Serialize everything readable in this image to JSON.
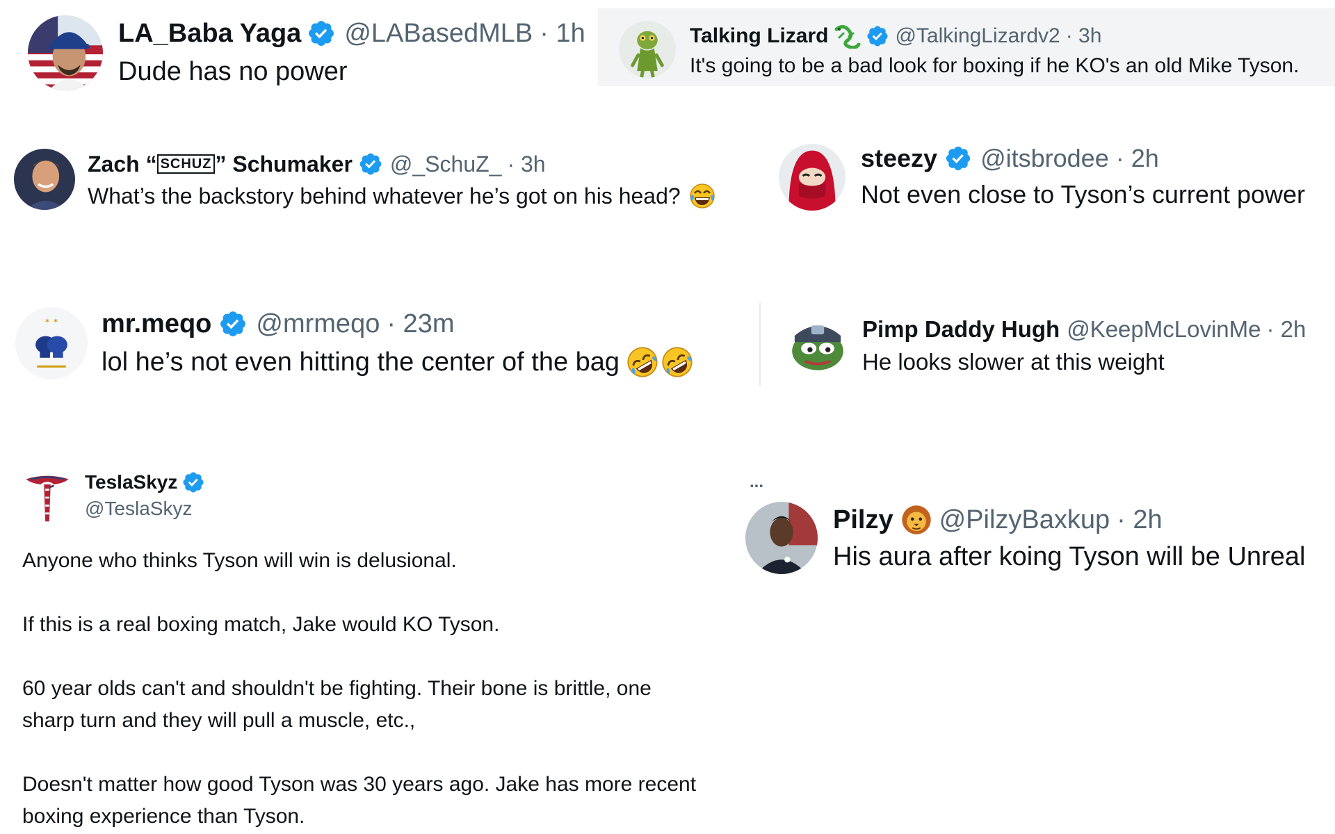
{
  "colors": {
    "text": "#0f1419",
    "secondary": "#536471",
    "verified": "#1d9bf0",
    "highlight_bg": "#f2f4f5",
    "divider": "#e6e8ea"
  },
  "tweets": [
    {
      "name": "LA_Baba Yaga",
      "handle": "@LABasedMLB",
      "time": "· 1h",
      "text": "Dude has no power",
      "icons": [
        "avatar-dodgers-man",
        "verified-badge-icon"
      ]
    },
    {
      "name": "Talking Lizard",
      "handle": "@TalkingLizardv2",
      "time": "· 3h",
      "text": "It's going to be a bad look for boxing if he KO's an old Mike Tyson.",
      "icons": [
        "avatar-gecko",
        "lizard-emoji",
        "verified-badge-icon"
      ]
    },
    {
      "name_prefix": "Zach “",
      "name_glyph": "SCHUZ",
      "name_suffix": "” Schumaker",
      "handle": "@_SchuZ_",
      "time": "· 3h",
      "text": "What’s the backstory behind whatever he’s got on his head?",
      "icons": [
        "avatar-man",
        "verified-badge-icon",
        "tears-of-joy-emoji"
      ]
    },
    {
      "name": "steezy",
      "handle": "@itsbrodee",
      "time": "· 2h",
      "text": "Not even close to Tyson’s current power",
      "icons": [
        "avatar-red-hood",
        "verified-badge-icon"
      ]
    },
    {
      "name": "mr.meqo",
      "handle": "@mrmeqo",
      "time": "· 23m",
      "text": "lol he’s not even hitting the center of the bag",
      "icons": [
        "avatar-boxing-gloves",
        "verified-badge-icon",
        "rofl-emoji",
        "rofl-emoji"
      ]
    },
    {
      "name": "Pimp Daddy Hugh",
      "handle": "@KeepMcLovinMe",
      "time": "· 2h",
      "text": "He looks slower at this weight",
      "icons": [
        "avatar-pepe-frog"
      ]
    },
    {
      "name": "TeslaSkyz",
      "handle": "@TeslaSkyz",
      "paragraphs": [
        "Anyone who thinks Tyson will win is delusional.",
        "If this is a real boxing match, Jake would KO Tyson.",
        "60 year olds can't and shouldn't be fighting. Their bone is brittle, one",
        "sharp turn and they will pull a muscle, etc.,",
        "Doesn't matter how good Tyson was 30 years ago. Jake has more recent",
        "boxing experience than Tyson."
      ],
      "icons": [
        "avatar-tesla-flag-logo",
        "verified-badge-icon"
      ]
    },
    {
      "more": "...",
      "name": "Pilzy",
      "handle": "@PilzyBaxkup",
      "time": "· 2h",
      "text": "His aura after koing Tyson will be Unreal",
      "icons": [
        "avatar-coach",
        "lion-emoji"
      ]
    }
  ]
}
